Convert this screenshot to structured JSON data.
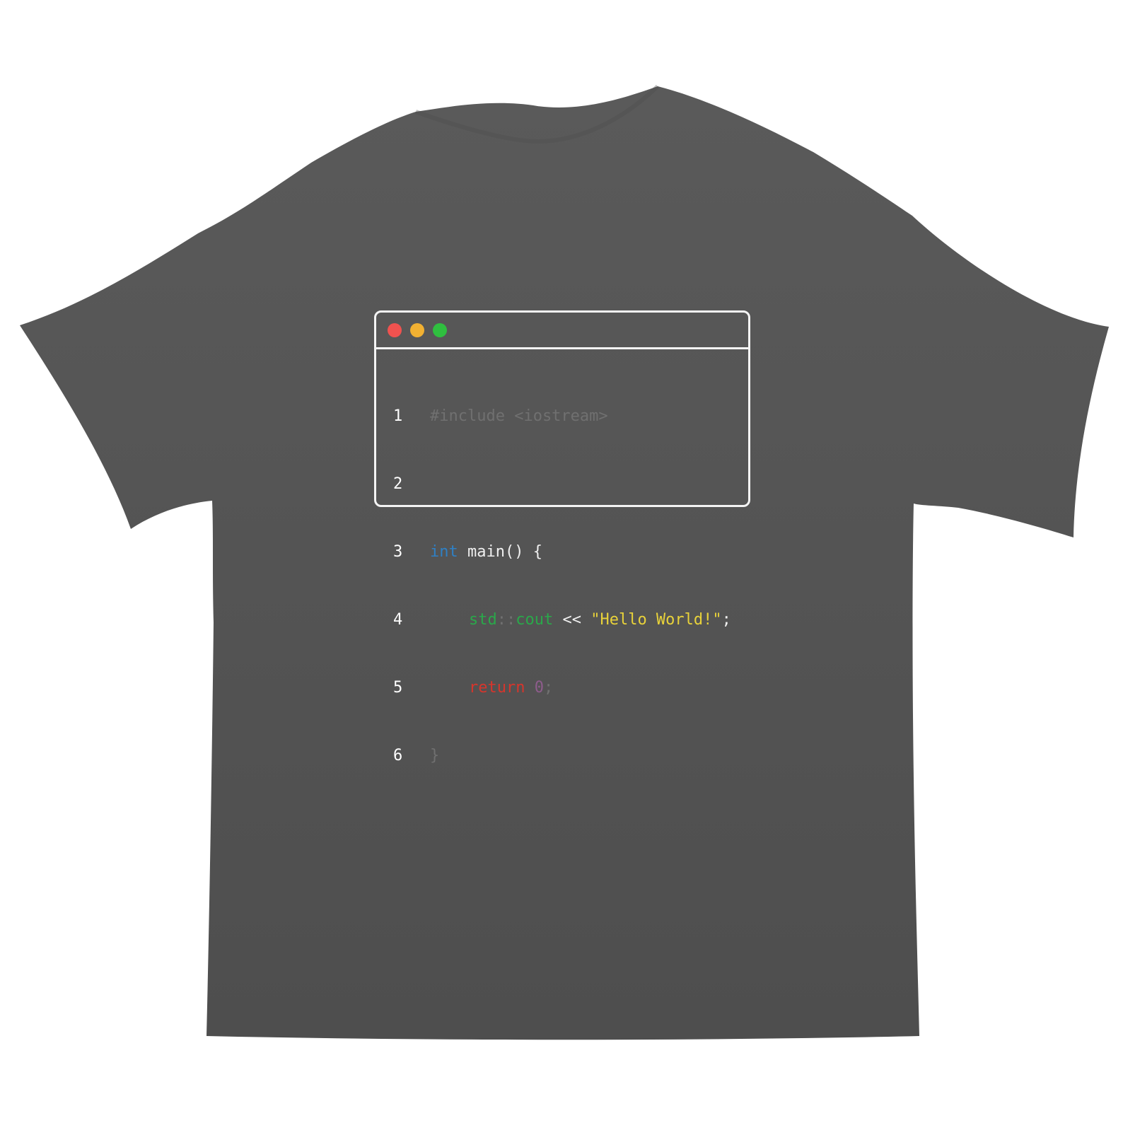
{
  "colors": {
    "background": "#ffffff",
    "shirt": "#5a5a5a",
    "shirt_shadow": "#4e4e4e",
    "window_outline": "#f4f4f4",
    "dot_red": "#f0524f",
    "dot_yellow": "#f2b132",
    "dot_green": "#2fbf3f",
    "keyword_int": "#2f80c4",
    "include_faint": "#707070",
    "namespace_green": "#2aa84a",
    "string_yellow": "#e8d23a",
    "return_red": "#d6352c",
    "number_purple": "#8e5c8c",
    "plain_text": "#f0f0f0"
  },
  "window": {
    "buttons": [
      "close-dot",
      "minimize-dot",
      "maximize-dot"
    ]
  },
  "code": {
    "line_numbers": [
      "1",
      "2",
      "3",
      "4",
      "5",
      "6"
    ],
    "line1": "#include <iostream>",
    "line3_keyword": "int",
    "line3_rest": " main() {",
    "line4_std": "std",
    "line4_sep": "::",
    "line4_cout": "cout",
    "line4_op": " << ",
    "line4_string": "\"Hello World!\"",
    "line4_semicolon": ";",
    "line5_return": "return",
    "line5_space": " ",
    "line5_zero": "0",
    "line5_semicolon": ";",
    "line6_brace": "}"
  }
}
